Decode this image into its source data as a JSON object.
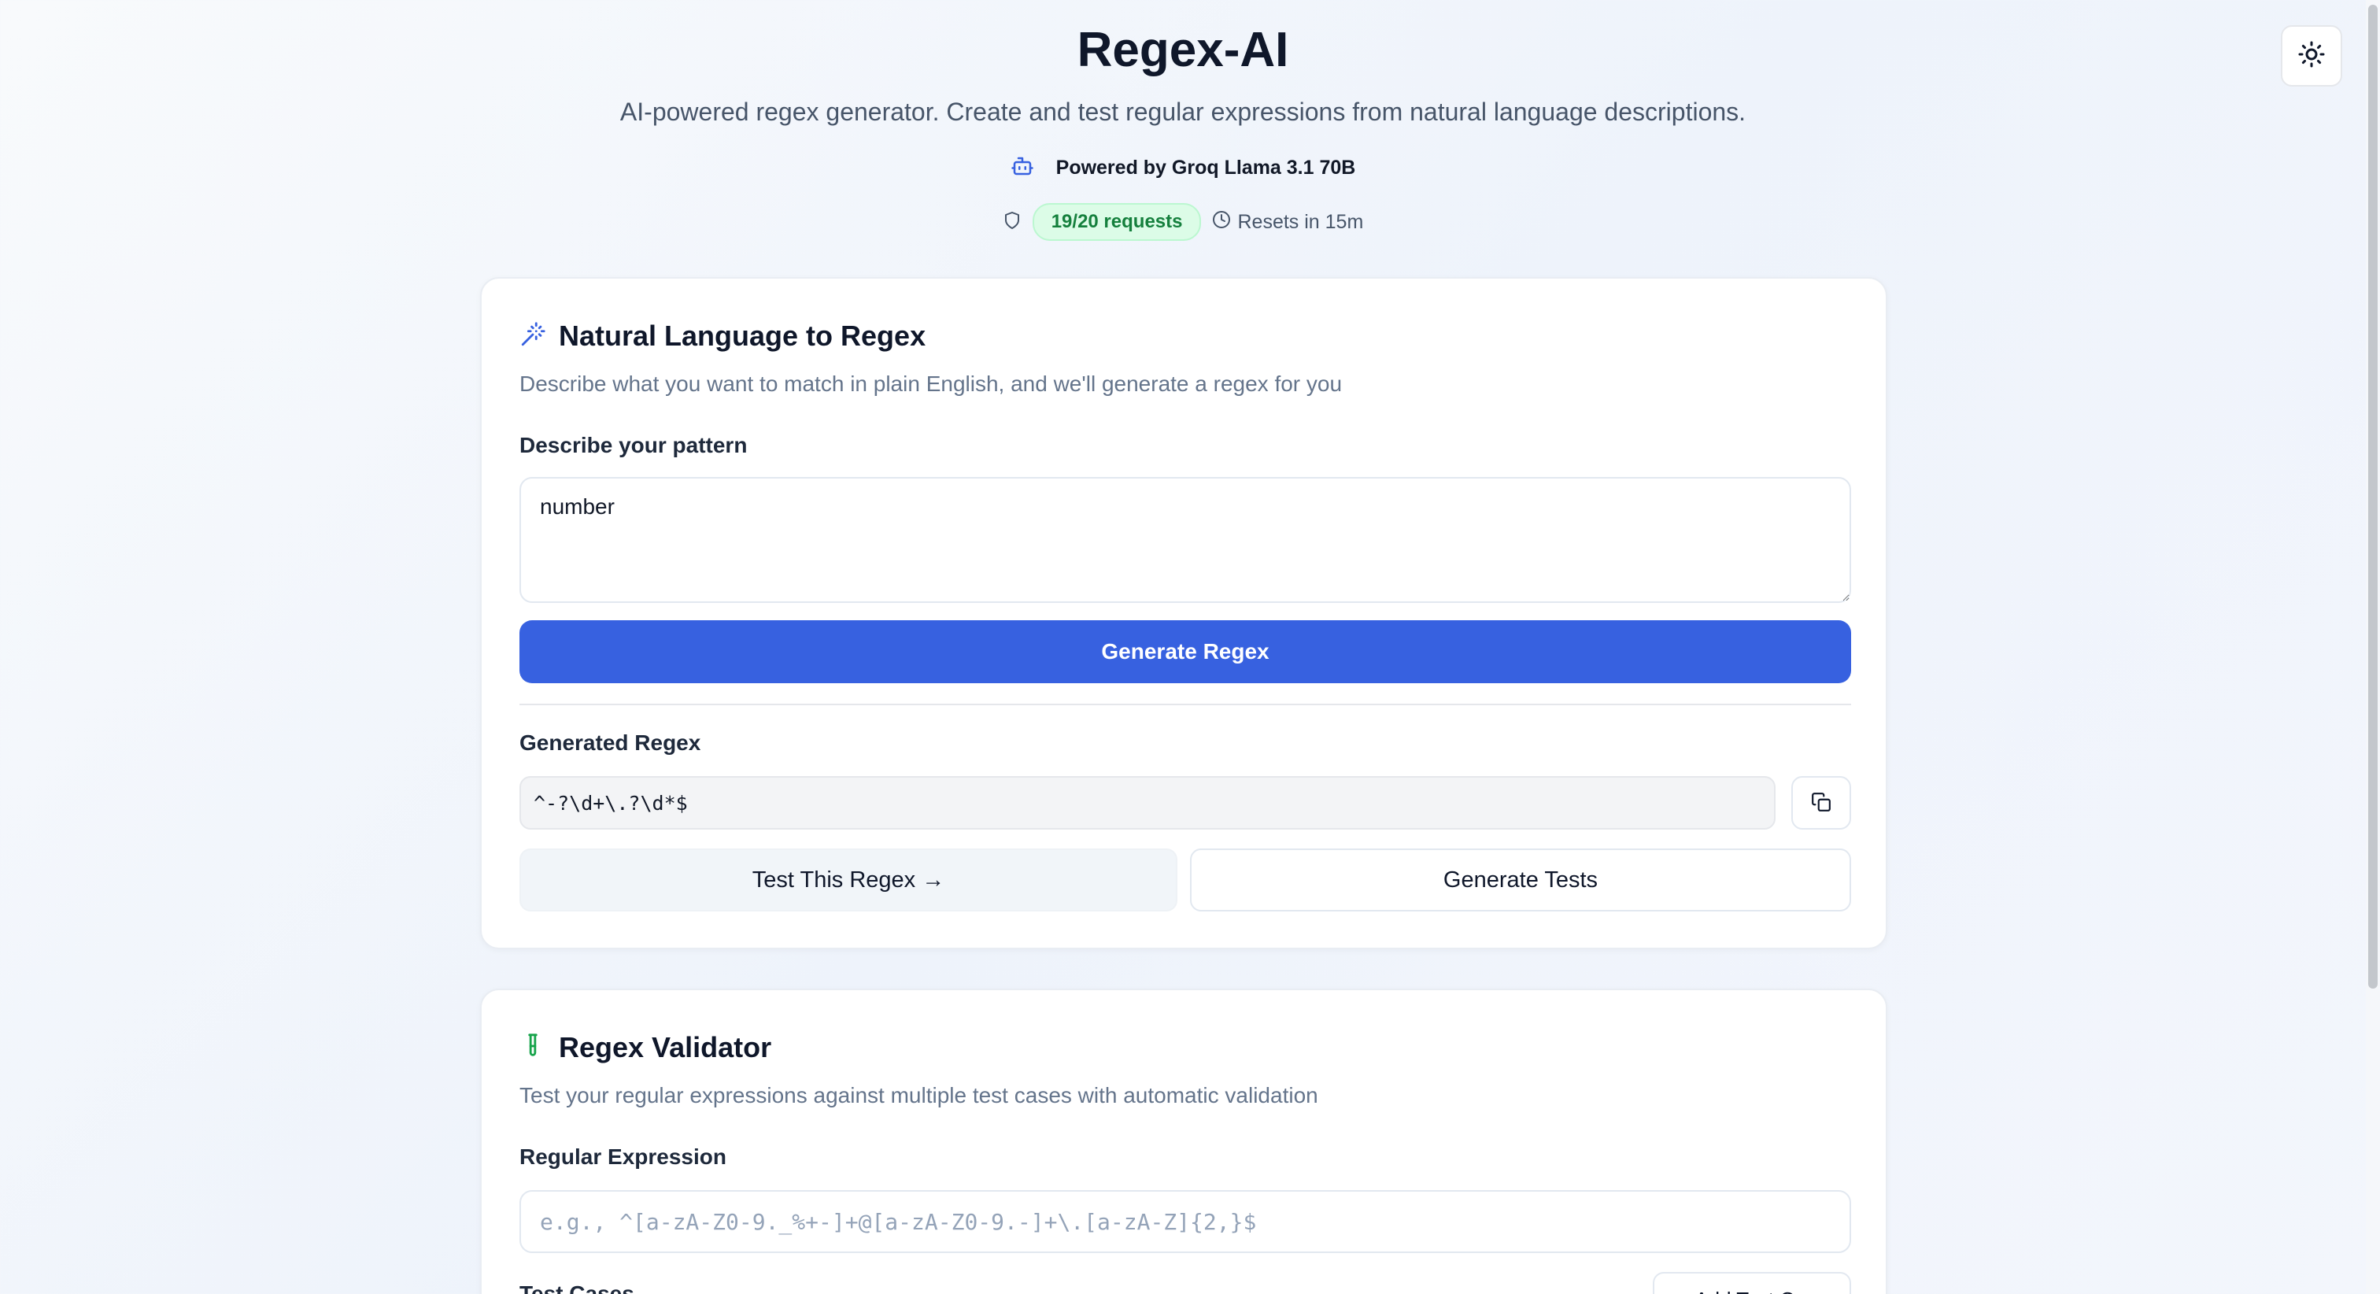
{
  "header": {
    "title": "Regex-AI",
    "subtitle": "AI-powered regex generator. Create and test regular expressions from natural language descriptions.",
    "powered_by": "Powered by Groq Llama 3.1 70B",
    "quota": "19/20 requests",
    "resets": "Resets in 15m"
  },
  "icons": {
    "theme": "sun-icon",
    "powered": "bot-icon",
    "quota": "shield-icon",
    "resets": "clock-icon",
    "nl_card": "wand-icon",
    "validator_card": "test-tube-icon",
    "copy": "copy-icon"
  },
  "colors": {
    "primary": "#3761e0",
    "badge_bg": "#dcfce7",
    "badge_text": "#15803d",
    "validator_icon": "#16a34a"
  },
  "nl_card": {
    "title": "Natural Language to Regex",
    "description": "Describe what you want to match in plain English, and we'll generate a regex for you",
    "pattern_label": "Describe your pattern",
    "pattern_value": "number",
    "generate_label": "Generate Regex",
    "generated_label": "Generated Regex",
    "generated_value": "^-?\\d+\\.?\\d*$",
    "test_label": "Test This Regex →",
    "generate_tests_label": "Generate Tests"
  },
  "validator_card": {
    "title": "Regex Validator",
    "description": "Test your regular expressions against multiple test cases with automatic validation",
    "regex_label": "Regular Expression",
    "regex_placeholder": "e.g., ^[a-zA-Z0-9._%+-]+@[a-zA-Z0-9.-]+\\.[a-zA-Z]{2,}$",
    "test_cases_label": "Test Cases",
    "add_label": "Add Test Case"
  }
}
